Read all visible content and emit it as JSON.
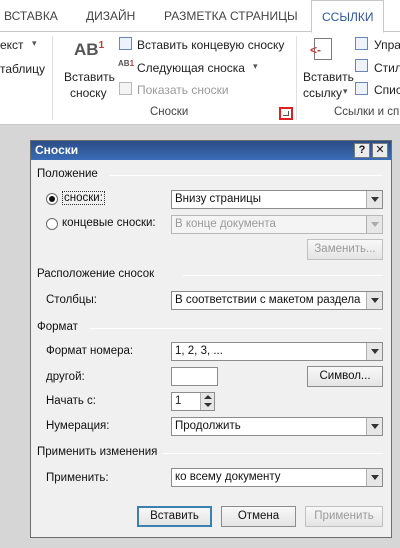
{
  "ribbon": {
    "tabs": [
      "ВСТАВКА",
      "ДИЗАЙН",
      "РАЗМЕТКА СТРАНИЦЫ",
      "ССЫЛКИ"
    ],
    "active_tab": "ССЫЛКИ",
    "left_partial": [
      "екст",
      "таблицу"
    ],
    "footnotes_group": {
      "insert_footnote_label_line1": "Вставить",
      "insert_footnote_label_line2": "сноску",
      "insert_endnote": "Вставить концевую сноску",
      "next_footnote": "Следующая сноска",
      "show_notes": "Показать сноски",
      "group_label": "Сноски"
    },
    "citations_group": {
      "insert_citation_line1": "Вставить",
      "insert_citation_line2": "ссылку",
      "manage_partial": "Упра",
      "style_partial": "Стил",
      "bibliography_partial": "Спис",
      "group_label": "Ссылки и сп"
    }
  },
  "dialog": {
    "title": "Сноски",
    "help_button": "?",
    "close_button": "✕",
    "position": {
      "heading": "Положение",
      "footnotes_label": "сноски:",
      "footnotes_value": "Внизу страницы",
      "endnotes_label": "концевые сноски:",
      "endnotes_value": "В конце документа",
      "replace_button": "Заменить...",
      "selected": "footnotes"
    },
    "layout": {
      "heading": "Расположение сносок",
      "columns_label": "Столбцы:",
      "columns_value": "В соответствии с макетом раздела"
    },
    "format": {
      "heading": "Формат",
      "number_format_label": "Формат номера:",
      "number_format_value": "1, 2, 3, ...",
      "custom_label": "другой:",
      "custom_value": "",
      "symbol_button": "Символ...",
      "start_at_label": "Начать с:",
      "start_at_value": "1",
      "numbering_label": "Нумерация:",
      "numbering_value": "Продолжить"
    },
    "apply": {
      "heading": "Применить изменения",
      "apply_to_label": "Применить:",
      "apply_to_value": "ко всему документу"
    },
    "buttons": {
      "insert": "Вставить",
      "cancel": "Отмена",
      "apply": "Применить"
    }
  }
}
